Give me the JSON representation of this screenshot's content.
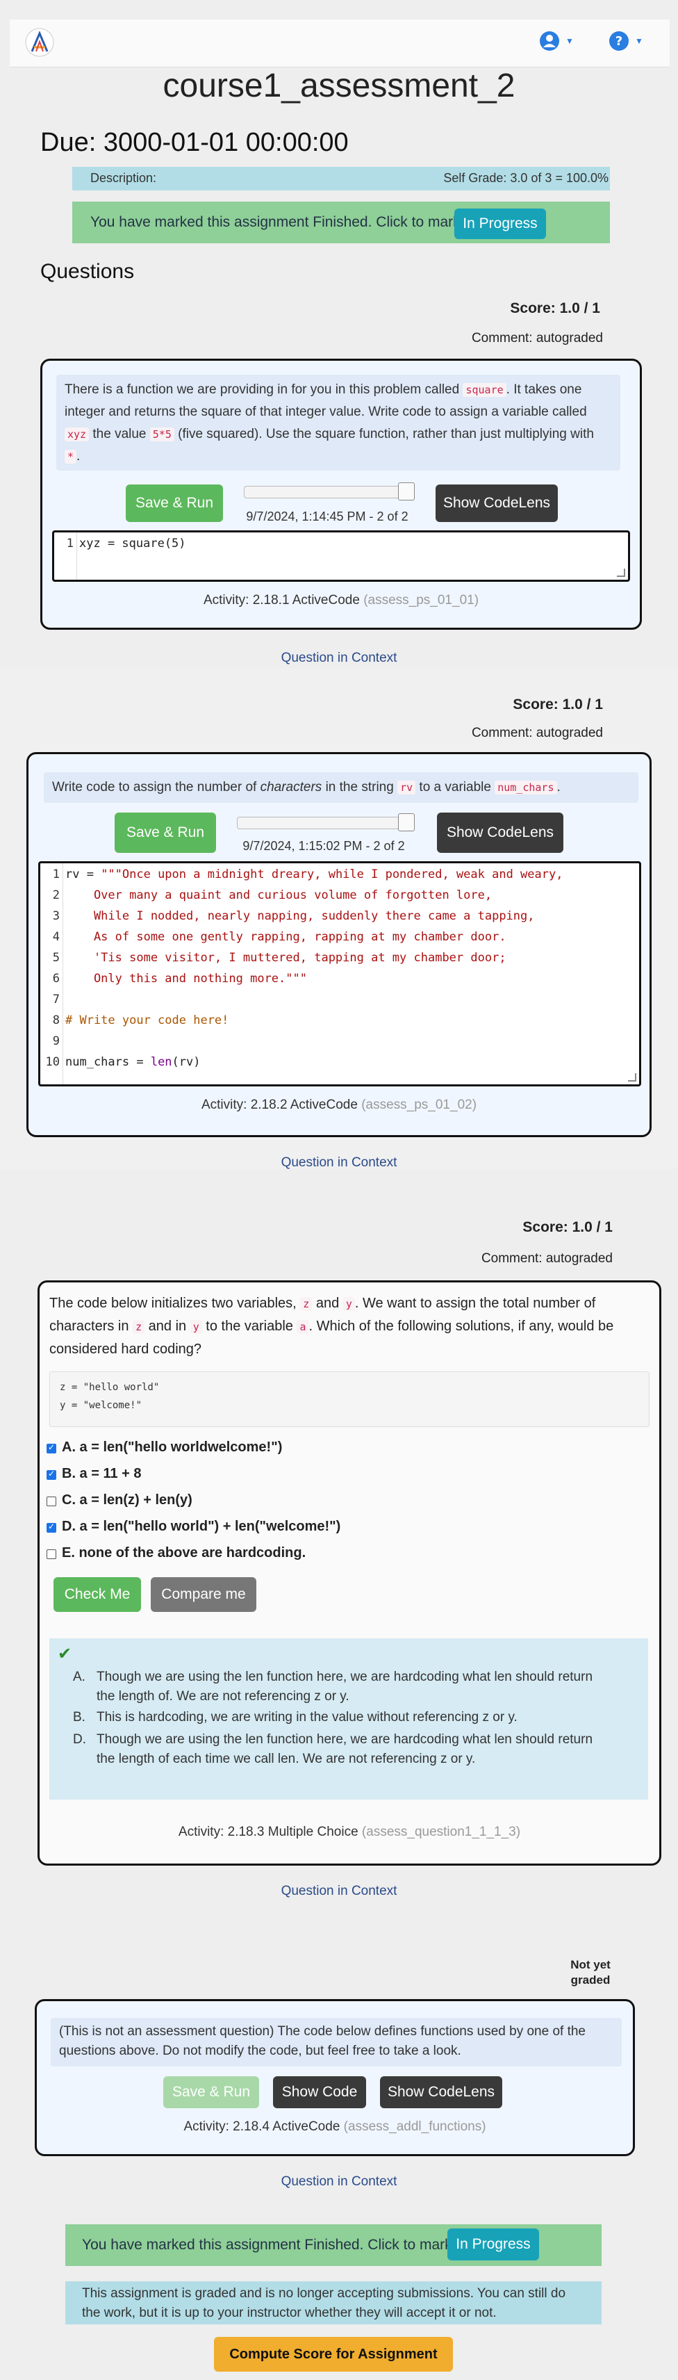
{
  "nav": {
    "user_icon": "user-circle-icon",
    "help_icon": "question-circle-icon"
  },
  "page": {
    "title": "course1_assessment_2",
    "due": "Due: 3000-01-01 00:00:00",
    "description_label": "Description:",
    "self_grade": "Self Grade: 3.0 of 3 = 100.0%",
    "finished_notice": "You have marked this assignment Finished. Click to mark it",
    "in_progress_label": "In Progress",
    "questions_heading": "Questions"
  },
  "q1": {
    "score": "Score: 1.0 / 1",
    "comment": "Comment: autograded",
    "prompt": {
      "p1": "There is a function we are providing in for you in this problem called ",
      "c1": "square",
      "p2": ". It takes one integer and returns the square of that integer value. Write code to assign a variable called ",
      "c2": "xyz",
      "p3": " the value ",
      "c3": "5*5",
      "p4": " (five squared). Use the square function, rather than just multiplying with ",
      "c4": "*",
      "p5": "."
    },
    "save_run": "Save & Run",
    "codelens": "Show CodeLens",
    "timestamp": "9/7/2024, 1:14:45 PM - 2 of 2",
    "code_line": "xyz = square(5)",
    "activity": "Activity: 2.18.1 ActiveCode",
    "activity_id": "(assess_ps_01_01)",
    "context_link": "Question in Context"
  },
  "q2": {
    "score": "Score: 1.0 / 1",
    "comment": "Comment: autograded",
    "prompt": {
      "p1": "Write code to assign the number of ",
      "em": "characters",
      "p2": " in the string ",
      "c1": "rv",
      "p3": " to a variable ",
      "c2": "num_chars",
      "p4": "."
    },
    "save_run": "Save & Run",
    "codelens": "Show CodeLens",
    "timestamp": "9/7/2024, 1:15:02 PM - 2 of 2",
    "lines": {
      "l1a": "rv = ",
      "l1b": "\"\"\"Once upon a midnight dreary, while I pondered, weak and weary,",
      "l2": "    Over many a quaint and curious volume of forgotten lore,",
      "l3": "    While I nodded, nearly napping, suddenly there came a tapping,",
      "l4": "    As of some one gently rapping, rapping at my chamber door.",
      "l5": "    'Tis some visitor, I muttered, tapping at my chamber door;",
      "l6": "    Only this and nothing more.\"\"\"",
      "l8": "# Write your code here!",
      "l10a": "num_chars = ",
      "l10b": "len",
      "l10c": "(rv)"
    },
    "activity": "Activity: 2.18.2 ActiveCode",
    "activity_id": "(assess_ps_01_02)",
    "context_link": "Question in Context"
  },
  "q3": {
    "score": "Score: 1.0 / 1",
    "comment": "Comment: autograded",
    "prompt": {
      "p1": "The code below initializes two variables, ",
      "c1": "z",
      "p2": " and ",
      "c2": "y",
      "p3": ". We want to assign the total number of characters in ",
      "c3": "z",
      "p4": " and in ",
      "c4": "y",
      "p5": " to the variable ",
      "c5": "a",
      "p6": ". Which of the following solutions, if any, would be considered hard coding?"
    },
    "code1": "z = \"hello world\"",
    "code2": "y = \"welcome!\"",
    "options": {
      "a": "A. a = len(\"hello worldwelcome!\")",
      "b": "B. a = 11 + 8",
      "c": "C. a = len(z) + len(y)",
      "d": "D. a = len(\"hello world\") + len(\"welcome!\")",
      "e": "E. none of the above are hardcoding."
    },
    "check_me": "Check Me",
    "compare_me": "Compare me",
    "feedback": {
      "a": "Though we are using the len function here, we are hardcoding what len should return the length of. We are not referencing z or y.",
      "b": "This is hardcoding, we are writing in the value without referencing z or y.",
      "d": "Though we are using the len function here, we are hardcoding what len should return the length of each time we call len. We are not referencing z or y."
    },
    "activity": "Activity: 2.18.3 Multiple Choice",
    "activity_id": "(assess_question1_1_1_3)",
    "context_link": "Question in Context"
  },
  "q4": {
    "status1": "Not yet",
    "status2": "graded",
    "prompt": "(This is not an assessment question) The code below defines functions used by one of the questions above. Do not modify the code, but feel free to take a look.",
    "save_run": "Save & Run",
    "show_code": "Show Code",
    "codelens": "Show CodeLens",
    "activity": "Activity: 2.18.4 ActiveCode",
    "activity_id": "(assess_addl_functions)",
    "context_link": "Question in Context"
  },
  "footer": {
    "finished_notice": "You have marked this assignment Finished. Click to mark it",
    "in_progress_label": "In Progress",
    "graded_notice": "This assignment is graded and is no longer accepting submissions. You can still do the work, but it is up to your instructor whether they will accept it or not.",
    "compute_score": "Compute Score for Assignment"
  }
}
